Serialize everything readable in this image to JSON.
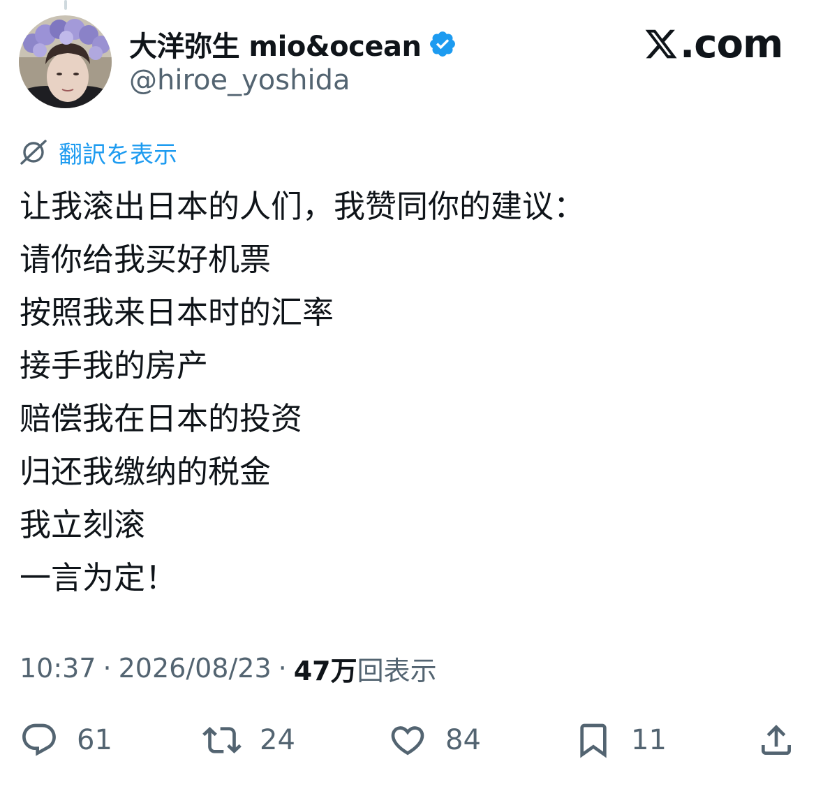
{
  "author": {
    "display_name": "大洋弥生 mio&ocean",
    "handle": "@hiroe_yoshida",
    "verified": true,
    "verified_color": "#1d9bf0"
  },
  "brand": {
    "logo_icon": "x-logo-icon",
    "domain": ".com"
  },
  "translate": {
    "icon": "translate-icon",
    "label": "翻訳を表示",
    "color": "#1d9bf0"
  },
  "tweet": {
    "lines": [
      "让我滚出日本的人们，我赞同你的建议：",
      "请你给我买好机票",
      "按照我来日本时的汇率",
      "接手我的房产",
      "赔偿我在日本的投资",
      "归还我缴纳的税金",
      "我立刻滚",
      "一言为定！"
    ]
  },
  "meta": {
    "time": "10:37",
    "separator": "·",
    "date": "2026/08/23",
    "views_count": "47万",
    "views_label": "回表示"
  },
  "actions": {
    "replies": "61",
    "reposts": "24",
    "likes": "84",
    "bookmarks": "11"
  },
  "colors": {
    "text": "#0f1419",
    "secondary": "#536471",
    "accent": "#1d9bf0"
  }
}
